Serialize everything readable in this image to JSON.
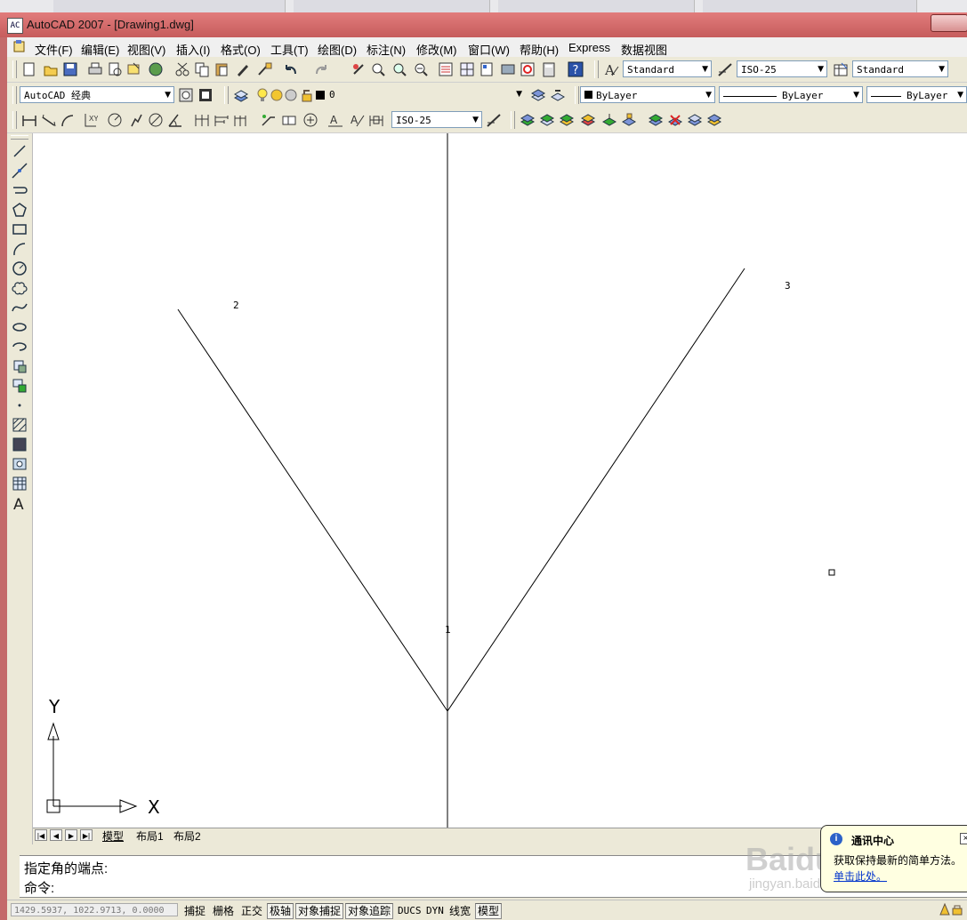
{
  "window": {
    "title": "AutoCAD 2007 - [Drawing1.dwg]",
    "app_icon_text": "AC"
  },
  "menubar": {
    "items": [
      "文件(F)",
      "编辑(E)",
      "视图(V)",
      "插入(I)",
      "格式(O)",
      "工具(T)",
      "绘图(D)",
      "标注(N)",
      "修改(M)",
      "窗口(W)",
      "帮助(H)",
      "Express",
      "数据视图"
    ]
  },
  "standard_toolbar": {
    "text_style": "Standard",
    "dim_style": "ISO-25",
    "table_style": "Standard"
  },
  "layers_toolbar": {
    "workspace": "AutoCAD 经典",
    "current_layer": "0",
    "color": "ByLayer",
    "linetype": "ByLayer",
    "lineweight": "ByLayer"
  },
  "dimension_toolbar": {
    "dim_style": "ISO-25"
  },
  "drawing": {
    "labels": {
      "p1": "1",
      "p2": "2",
      "p3": "3"
    },
    "ucs": {
      "x_label": "X",
      "y_label": "Y"
    }
  },
  "layout_tabs": [
    "模型",
    "布局1",
    "布局2"
  ],
  "command_lines": [
    "指定角的端点:",
    "命令:"
  ],
  "status_bar": {
    "coordinates": "1429.5937, 1022.9713, 0.0000",
    "toggles": [
      {
        "label": "捕捉",
        "on": false
      },
      {
        "label": "栅格",
        "on": false
      },
      {
        "label": "正交",
        "on": false
      },
      {
        "label": "极轴",
        "on": true
      },
      {
        "label": "对象捕捉",
        "on": true
      },
      {
        "label": "对象追踪",
        "on": true
      },
      {
        "label": "DUCS",
        "on": false
      },
      {
        "label": "DYN",
        "on": false
      },
      {
        "label": "线宽",
        "on": false
      }
    ],
    "space": "模型"
  },
  "notification": {
    "title": "通讯中心",
    "body": "获取保持最新的简单方法。",
    "link": "单击此处。"
  },
  "watermark": {
    "brand": "Baidu经验",
    "url": "jingyan.baidu.com"
  },
  "colors": {
    "title_bar": "#c65c5c",
    "toolbar_bg": "#ece9d8",
    "canvas_bg": "#ffffff",
    "balloon_bg": "#ffffe1"
  }
}
